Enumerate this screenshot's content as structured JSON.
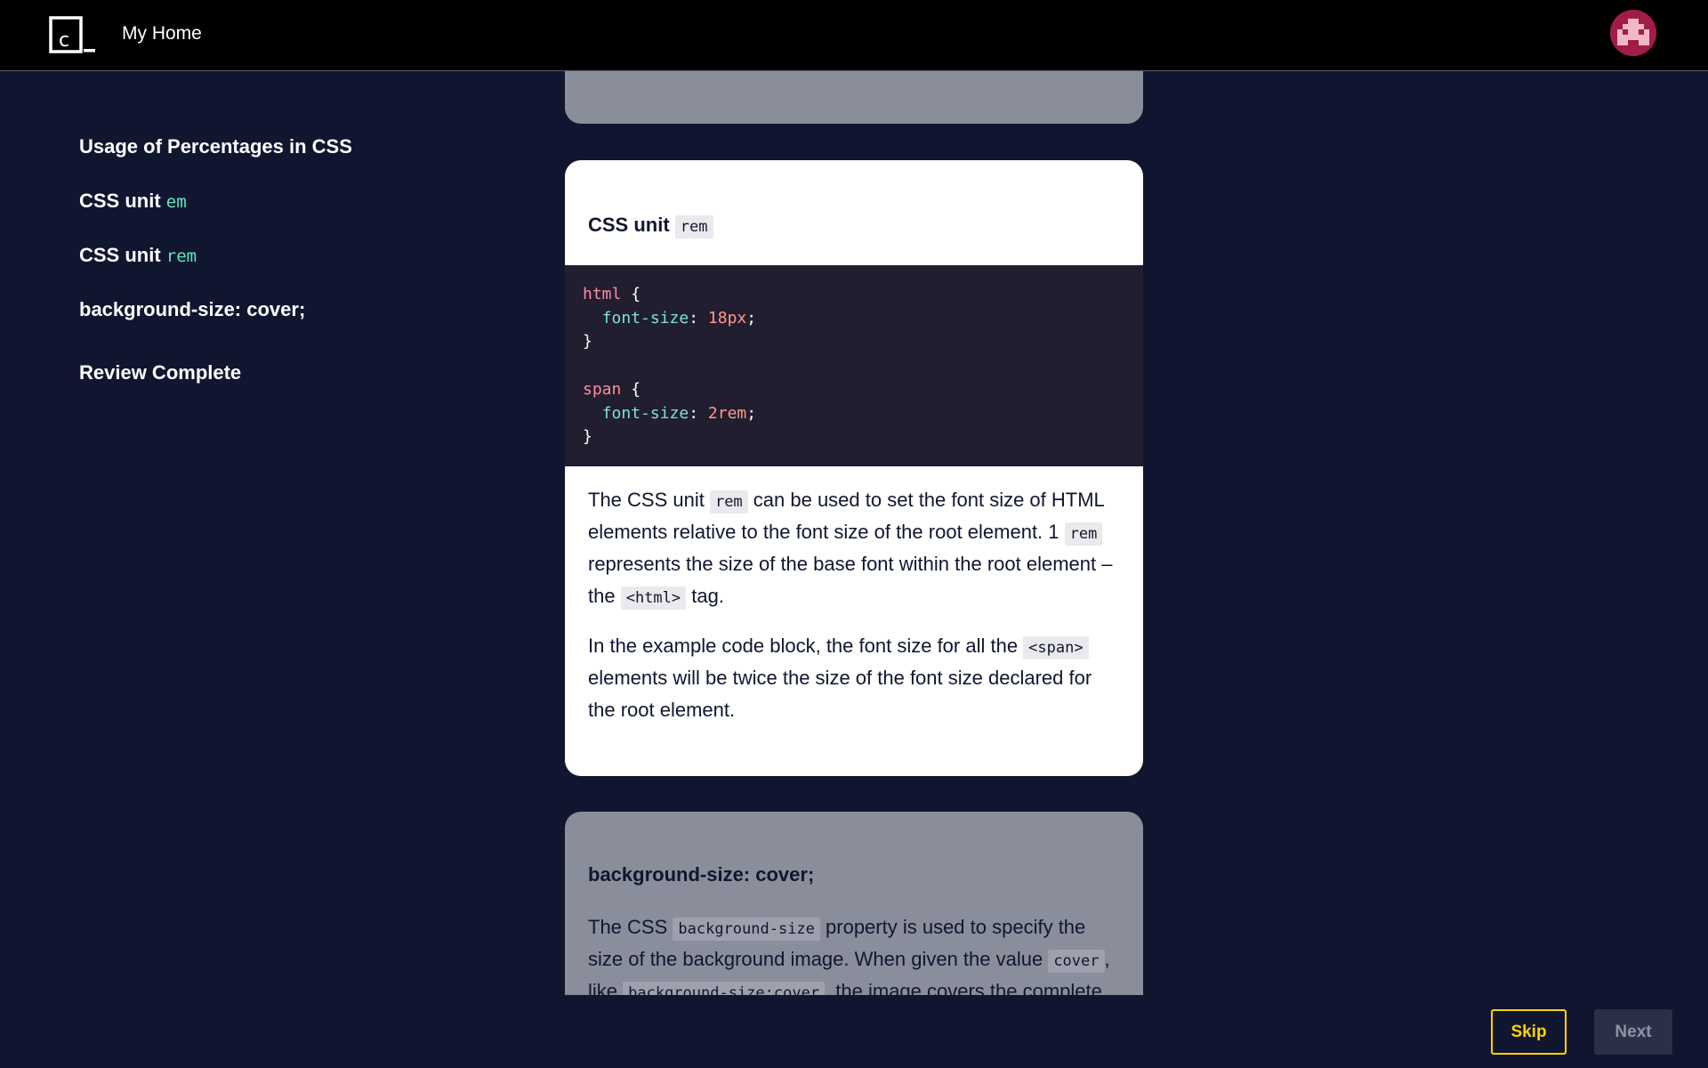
{
  "header": {
    "nav_home": "My Home"
  },
  "sidebar": {
    "items": [
      {
        "label": "Usage of Percentages in CSS"
      },
      {
        "label": "CSS unit ",
        "code": "em"
      },
      {
        "label": "CSS unit ",
        "code": "rem"
      },
      {
        "label": "background-size: cover;"
      },
      {
        "label": "Review Complete"
      }
    ]
  },
  "main_card": {
    "title_text": "CSS unit ",
    "title_code": "rem",
    "code_lines": [
      {
        "selector": "html",
        "open": " {"
      },
      {
        "property": "font-size",
        "value": "18px"
      },
      {
        "close": "}"
      },
      {
        "blank": ""
      },
      {
        "selector": "span",
        "open": " {"
      },
      {
        "property": "font-size",
        "value": "2rem"
      },
      {
        "close": "}"
      }
    ],
    "p1": {
      "t1": "The CSS unit ",
      "c1": "rem",
      "t2": " can be used to set the font size of HTML elements relative to the font size of the root element. 1 ",
      "c2": "rem",
      "t3": " represents the size of the base font within the root element – the ",
      "c3": "<html>",
      "t4": " tag."
    },
    "p2": {
      "t1": "In the example code block, the font size for all the ",
      "c1": "<span>",
      "t2": " elements will be twice the size of the font size declared for the root element."
    }
  },
  "next_card": {
    "title": "background-size: cover;",
    "p1": {
      "t1": "The CSS ",
      "c1": "background-size",
      "t2": " property is used to specify the size of the background image. When given the value ",
      "c2": "cover",
      "t3": ", like ",
      "c3": "background-size:cover",
      "t4": ", the image covers the complete"
    }
  },
  "footer": {
    "skip_label": "Skip",
    "next_label": "Next"
  },
  "colors": {
    "background": "#10162f",
    "accent_yellow": "#ffd300",
    "code_teal": "#5ee8c0",
    "avatar": "#a11d46"
  }
}
